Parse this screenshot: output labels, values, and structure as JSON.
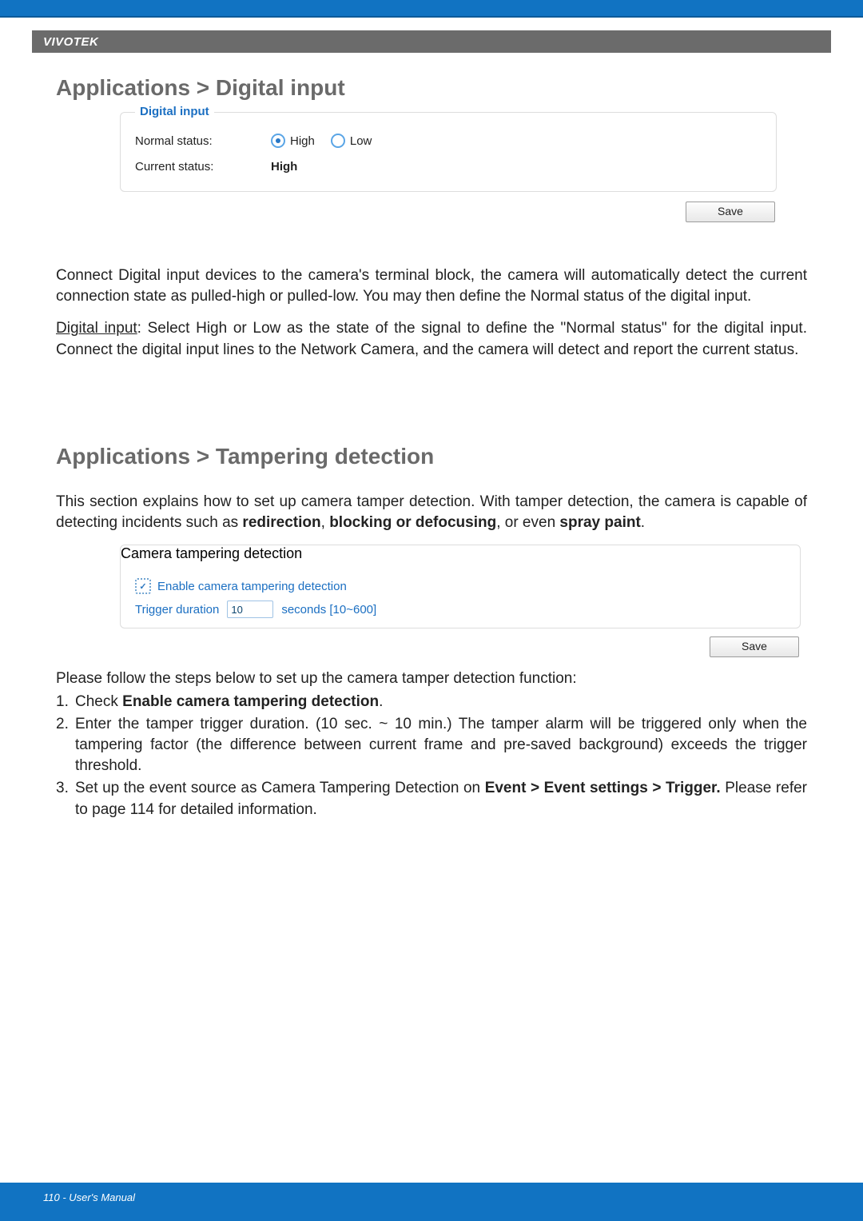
{
  "brand": "VIVOTEK",
  "h1a": "Applications > Digital input",
  "digital_input": {
    "legend": "Digital input",
    "normal_status_label": "Normal status:",
    "high_label": "High",
    "low_label": "Low",
    "selected": "High",
    "current_status_label": "Current status:",
    "current_status_value": "High",
    "save": "Save"
  },
  "p_di_1": "Connect Digital input devices to the camera's terminal block, the camera will automatically detect the current connection state as pulled-high or pulled-low. You may then define the Normal status of the digital input.",
  "p_di_2_lead": "Digital input",
  "p_di_2_tail": ": Select High or Low as the state of the signal to define the \"Normal status\" for the digital input. Connect the digital input lines to the Network Camera, and the camera will detect and report the current status.",
  "h1b": "Applications > Tampering detection",
  "p_td_1a": "This section explains how to set up camera tamper detection. With tamper detection, the camera is capable of detecting incidents such as ",
  "p_td_1_bold1": "redirection",
  "p_td_1_mid": ", ",
  "p_td_1_bold2": "blocking or defocusing",
  "p_td_1_after": ", or even ",
  "p_td_1_bold3": "spray paint",
  "p_td_1_end": ".",
  "tamper": {
    "legend": "Camera tampering detection",
    "enable_label": "Enable camera tampering detection",
    "trigger_label": "Trigger duration",
    "trigger_value": "10",
    "trigger_units": "seconds [10~600]",
    "save": "Save"
  },
  "steps_intro": "Please follow the steps below to set up the camera tamper detection function:",
  "steps": {
    "s1a": "Check ",
    "s1b_bold": "Enable camera tampering detection",
    "s1c": ".",
    "s2": "Enter the tamper trigger duration. (10 sec. ~ 10 min.) The tamper alarm will be triggered only when the tampering factor (the difference between current frame and pre-saved background) exceeds the trigger threshold.",
    "s3a": "Set up the event source as Camera Tampering Detection on ",
    "s3b_bold": "Event > Event settings > Trigger.",
    "s3c": " Please refer to page 114 for detailed information."
  },
  "footer": "110 - User's Manual"
}
